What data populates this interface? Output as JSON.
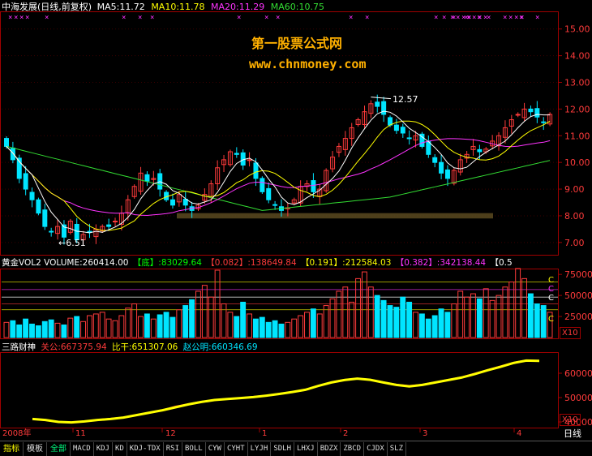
{
  "header": {
    "stock": "中海发展(日线,前复权)",
    "ma5": "MA5:11.72",
    "ma10": "MA10:11.78",
    "ma20": "MA20:11.29",
    "ma60": "MA60:10.75"
  },
  "watermark": {
    "line1": "第一股票公式网",
    "line2": "www.chnmoney.com"
  },
  "annotations": {
    "high": "12.57",
    "low": "6.51"
  },
  "vol_header": {
    "name": "黄金VOL2",
    "volume": "VOLUME:260414.00",
    "b0": "【底】",
    "v0": ":83029.64",
    "b1": "【0.082】",
    "v1": ":138649.84",
    "b2": "【0.191】",
    "v2": ":212584.03",
    "b3": "【0.382】",
    "v3": ":342138.44",
    "b4": "【0.5"
  },
  "ind_header": {
    "name": "三路财神",
    "a": "关公:667375.94",
    "b": "比干:651307.06",
    "c": "赵公明:660346.69"
  },
  "x10_labels": [
    "X10",
    "X10"
  ],
  "date_axis": [
    "2008年",
    "11",
    "12",
    "1",
    "2",
    "3",
    "4"
  ],
  "date_axis_right": "日线",
  "vol_side_letters": [
    "C",
    "C",
    "C",
    "C"
  ],
  "tabs": [
    "指标",
    "模板",
    "全部",
    "MACD",
    "KDJ",
    "KD",
    "KDJ-TDX",
    "RSI",
    "BOLL",
    "CYW",
    "CYHT",
    "LYJH",
    "SDLH",
    "LHXJ",
    "BDZX",
    "ZBCD",
    "CJDX",
    "SLZ"
  ],
  "colors": {
    "up": "#ff3b3b",
    "down": "#00e5ff",
    "ma5": "#ffffff",
    "ma10": "#ffff00",
    "ma20": "#ff33ff",
    "ma60": "#33dd33",
    "watermark": "#ffb000"
  },
  "chart_data": [
    {
      "type": "candlestick",
      "title": "中海发展(日线,前复权)",
      "ylim": [
        6.6,
        15.6
      ],
      "yticks": [
        7.0,
        8.0,
        9.0,
        10.0,
        11.0,
        12.0,
        13.0,
        14.0,
        15.0
      ],
      "ylabels": [
        "7.00",
        "8.00",
        "9.00",
        "10.00",
        "11.00",
        "12.00",
        "13.00",
        "14.00",
        "15.00"
      ],
      "high_marker": 12.57,
      "low_marker": 6.51,
      "closes": [
        10.6,
        10.1,
        9.4,
        9.0,
        8.6,
        8.1,
        7.6,
        7.4,
        7.6,
        7.2,
        7.8,
        7.1,
        7.3,
        7.4,
        7.5,
        7.6,
        7.6,
        7.8,
        8.1,
        8.6,
        9.1,
        9.6,
        9.3,
        9.4,
        9.0,
        8.6,
        8.4,
        8.8,
        8.4,
        8.2,
        8.4,
        8.8,
        9.2,
        9.8,
        10.1,
        10.4,
        10.3,
        9.9,
        10.1,
        9.4,
        8.9,
        8.6,
        8.4,
        8.2,
        8.3,
        8.6,
        9.1,
        9.2,
        8.9,
        9.0,
        9.7,
        10.2,
        10.6,
        10.9,
        11.3,
        11.6,
        11.9,
        12.2,
        12.1,
        11.8,
        11.4,
        11.2,
        11.1,
        10.9,
        11.0,
        10.6,
        10.3,
        10.0,
        9.6,
        9.4,
        9.7,
        10.1,
        10.3,
        10.6,
        10.4,
        10.5,
        10.8,
        11.0,
        11.3,
        11.6,
        11.8,
        12.0,
        11.9,
        11.7,
        11.5,
        11.8
      ]
    },
    {
      "type": "bar",
      "title": "黄金VOL2",
      "ylim": [
        0,
        80000
      ],
      "yticks": [
        25000,
        50000,
        75000
      ],
      "ylabels": [
        "25000",
        "50000",
        "75000"
      ],
      "levels": [
        {
          "name": "【底】",
          "value": 83029.64
        },
        {
          "name": "【0.082】",
          "value": 138649.84
        },
        {
          "name": "【0.191】",
          "value": 212584.03
        },
        {
          "name": "【0.382】",
          "value": 342138.44
        }
      ],
      "values": [
        18,
        20,
        15,
        22,
        16,
        14,
        19,
        21,
        17,
        15,
        23,
        25,
        19,
        26,
        28,
        30,
        22,
        20,
        26,
        35,
        40,
        25,
        28,
        22,
        27,
        30,
        24,
        33,
        38,
        45,
        55,
        62,
        48,
        80,
        40,
        30,
        25,
        42,
        28,
        22,
        24,
        18,
        20,
        16,
        18,
        22,
        26,
        30,
        34,
        28,
        38,
        46,
        55,
        60,
        42,
        70,
        78,
        60,
        50,
        44,
        38,
        36,
        48,
        42,
        30,
        28,
        22,
        26,
        34,
        30,
        40,
        55,
        48,
        52,
        46,
        58,
        44,
        50,
        60,
        66,
        82,
        70,
        52,
        40,
        38,
        30
      ]
    },
    {
      "type": "line",
      "title": "三路财神",
      "ylim": [
        38000,
        68000
      ],
      "yticks": [
        40000,
        50000,
        60000
      ],
      "ylabels": [
        "40000",
        "50000",
        "60000"
      ],
      "series": [
        {
          "name": "关公",
          "values": [
            41000,
            40500,
            40200,
            40000,
            40400,
            41000,
            41500,
            42000,
            43000,
            44000,
            45000,
            46500,
            47500,
            48500,
            49000,
            49500,
            50000,
            50500,
            51000,
            51800,
            52500,
            53500,
            55000,
            56500,
            57500,
            58000,
            57500,
            56500,
            55500,
            55000,
            55500,
            56500,
            57500,
            58500,
            60000,
            61500,
            63000,
            64500,
            65500,
            65000
          ]
        },
        {
          "name": "比干",
          "values": [
            41200,
            40800,
            40000,
            39800,
            40200,
            40800,
            41200,
            41800,
            42800,
            43800,
            44800,
            46000,
            47200,
            48200,
            49000,
            49400,
            49800,
            50200,
            50800,
            51500,
            52300,
            53200,
            54800,
            56200,
            57200,
            57800,
            57300,
            56200,
            55200,
            54600,
            55200,
            56200,
            57200,
            58200,
            59600,
            61200,
            62600,
            64200,
            65200,
            65100
          ]
        },
        {
          "name": "赵公明",
          "values": [
            41100,
            40700,
            40100,
            39900,
            40300,
            40900,
            41400,
            41900,
            42900,
            43900,
            44900,
            46200,
            47300,
            48300,
            49000,
            49400,
            49900,
            50300,
            50900,
            51600,
            52400,
            53300,
            54900,
            56300,
            57300,
            57900,
            57400,
            56300,
            55300,
            54800,
            55300,
            56300,
            57300,
            58300,
            59800,
            61300,
            62800,
            64300,
            65300,
            65000
          ]
        }
      ]
    }
  ]
}
